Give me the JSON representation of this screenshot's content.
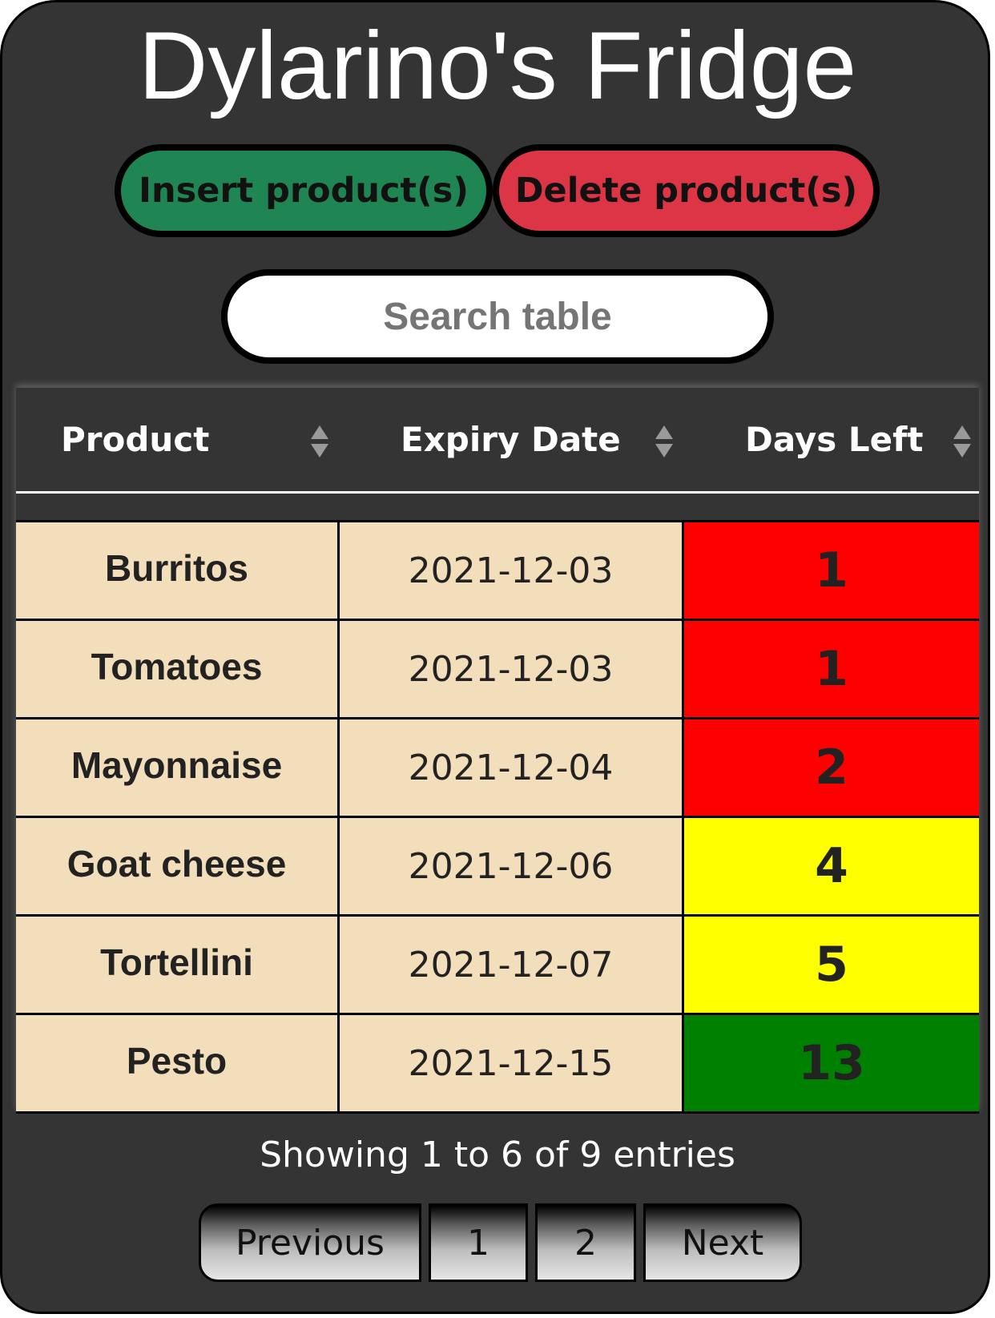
{
  "header": {
    "title": "Dylarino's Fridge"
  },
  "actions": {
    "insert_label": "Insert product(s)",
    "delete_label": "Delete product(s)"
  },
  "search": {
    "placeholder": "Search table",
    "value": ""
  },
  "table": {
    "columns": [
      {
        "label": "Product",
        "icon": "sort-icon"
      },
      {
        "label": "Expiry Date",
        "icon": "sort-icon"
      },
      {
        "label": "Days Left",
        "icon": "sort-icon"
      }
    ],
    "rows": [
      {
        "product": "Burritos",
        "expiry": "2021-12-03",
        "days_left": "1",
        "status_color": "#ff0000"
      },
      {
        "product": "Tomatoes",
        "expiry": "2021-12-03",
        "days_left": "1",
        "status_color": "#ff0000"
      },
      {
        "product": "Mayonnaise",
        "expiry": "2021-12-04",
        "days_left": "2",
        "status_color": "#ff0000"
      },
      {
        "product": "Goat cheese",
        "expiry": "2021-12-06",
        "days_left": "4",
        "status_color": "#ffff00"
      },
      {
        "product": "Tortellini",
        "expiry": "2021-12-07",
        "days_left": "5",
        "status_color": "#ffff00"
      },
      {
        "product": "Pesto",
        "expiry": "2021-12-15",
        "days_left": "13",
        "status_color": "#008000"
      }
    ]
  },
  "footer": {
    "info": "Showing 1 to 6 of 9 entries",
    "pagination": {
      "previous_label": "Previous",
      "pages": [
        "1",
        "2"
      ],
      "next_label": "Next"
    }
  },
  "colors": {
    "background": "#343434",
    "insert_button": "#1e8553",
    "delete_button": "#dc3545",
    "row_background": "#f3debb",
    "status_red": "#ff0000",
    "status_yellow": "#ffff00",
    "status_green": "#008000"
  }
}
